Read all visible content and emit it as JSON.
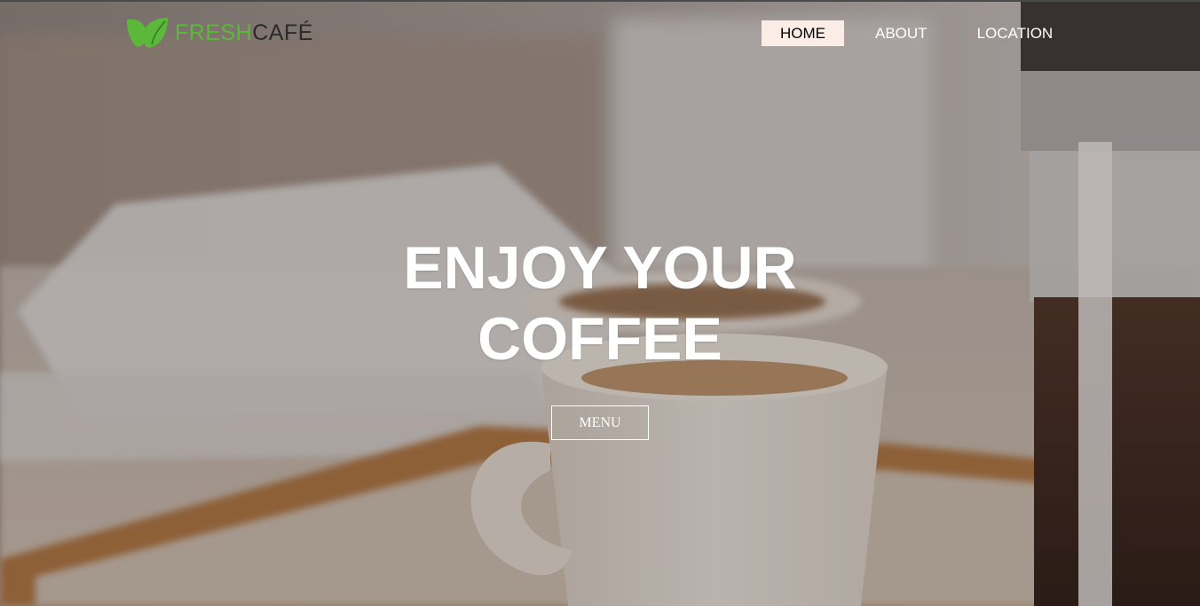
{
  "logo": {
    "word_fresh": "FRESH",
    "word_cafe": "CAFÉ",
    "icon": "leaf-icon",
    "colors": {
      "fresh": "#5cb83a",
      "cafe": "#2b2b2b"
    }
  },
  "nav": {
    "items": [
      {
        "label": "HOME",
        "active": true
      },
      {
        "label": "ABOUT",
        "active": false
      },
      {
        "label": "LOCATION",
        "active": false
      }
    ],
    "active_bg": "#fbede6"
  },
  "hero": {
    "headline_line1": "ENJOY YOUR",
    "headline_line2": "COFFEE",
    "cta_label": "MENU"
  }
}
